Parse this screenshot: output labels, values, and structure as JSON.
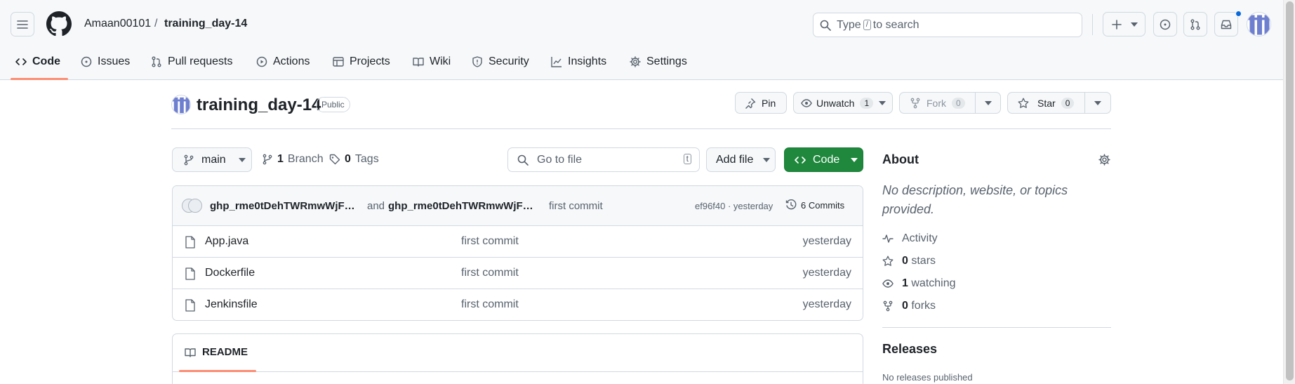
{
  "header": {
    "owner": "Amaan00101",
    "separator": "/",
    "repo": "training_day-14",
    "search_prefix": "Type",
    "search_key": "/",
    "search_suffix": "to search"
  },
  "tabs": [
    {
      "label": "Code",
      "icon": "code-icon"
    },
    {
      "label": "Issues",
      "icon": "issue-opened-icon"
    },
    {
      "label": "Pull requests",
      "icon": "git-pull-request-icon"
    },
    {
      "label": "Actions",
      "icon": "play-icon"
    },
    {
      "label": "Projects",
      "icon": "table-icon"
    },
    {
      "label": "Wiki",
      "icon": "book-icon"
    },
    {
      "label": "Security",
      "icon": "shield-icon"
    },
    {
      "label": "Insights",
      "icon": "graph-icon"
    },
    {
      "label": "Settings",
      "icon": "gear-icon"
    }
  ],
  "repo_header": {
    "name": "training_day-14",
    "visibility": "Public",
    "pin_label": "Pin",
    "unwatch_label": "Unwatch",
    "watch_count": "1",
    "fork_label": "Fork",
    "fork_count": "0",
    "star_label": "Star",
    "star_count": "0"
  },
  "toolbar": {
    "branch": "main",
    "branch_count": "1",
    "branch_label": "Branch",
    "tag_count": "0",
    "tag_label": "Tags",
    "goto_placeholder": "Go to file",
    "goto_key": "t",
    "add_file_label": "Add file",
    "code_label": "Code"
  },
  "commit": {
    "author1": "ghp_rme0tDehTWRmwWjF…",
    "and": "and",
    "author2": "ghp_rme0tDehTWRmwWjF…",
    "message": "first commit",
    "hash_time": "ef96f40 · yesterday",
    "commits_label": "6 Commits"
  },
  "files": [
    {
      "name": "App.java",
      "message": "first commit",
      "time": "yesterday"
    },
    {
      "name": "Dockerfile",
      "message": "first commit",
      "time": "yesterday"
    },
    {
      "name": "Jenkinsfile",
      "message": "first commit",
      "time": "yesterday"
    }
  ],
  "readme": {
    "label": "README"
  },
  "about": {
    "title": "About",
    "description": "No description, website, or topics provided.",
    "activity": "Activity",
    "stars_count": "0",
    "stars_label": "stars",
    "watching_count": "1",
    "watching_label": "watching",
    "forks_count": "0",
    "forks_label": "forks"
  },
  "releases": {
    "title": "Releases",
    "empty": "No releases published"
  },
  "colors": {
    "accent_underline": "#fd8c73",
    "code_button": "#1f883d",
    "notification_dot": "#0969da"
  }
}
